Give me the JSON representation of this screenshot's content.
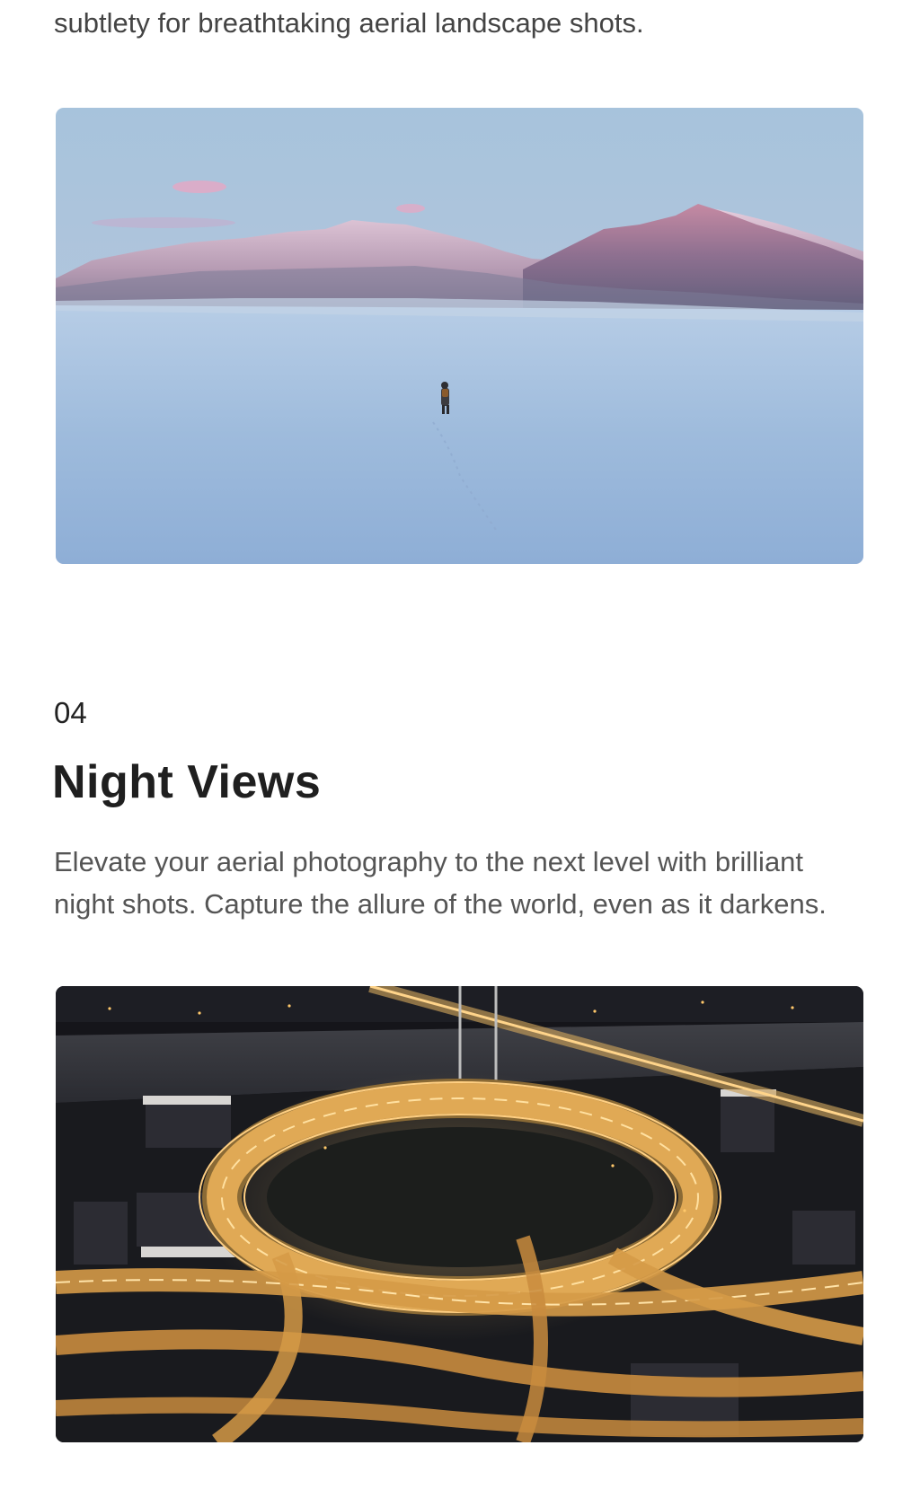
{
  "intro": {
    "text": "subtlety for breathtaking aerial landscape shots."
  },
  "images": {
    "winter": {
      "icon": "snowy-mountain-landscape-photo"
    },
    "night": {
      "icon": "night-highway-interchange-photo"
    }
  },
  "section": {
    "number": "04",
    "title": "Night Views",
    "description_line1": "Elevate your aerial photography to the next level with brilliant",
    "description_line2": "night shots. Capture the allure of the world, even as it darkens."
  },
  "colors": {
    "heading": "#1f1f1f",
    "body_text": "#555555",
    "background": "#ffffff"
  }
}
